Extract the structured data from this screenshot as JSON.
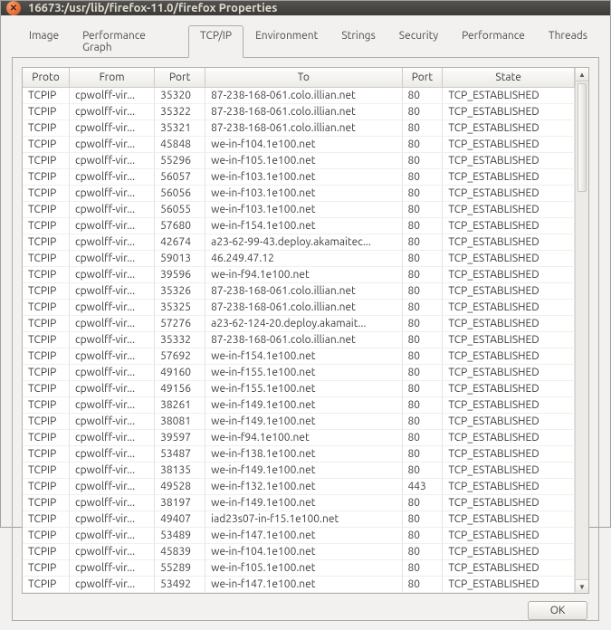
{
  "window": {
    "title": "16673:/usr/lib/firefox-11.0/firefox  Properties"
  },
  "tabs": [
    {
      "label": "Image"
    },
    {
      "label": "Performance Graph"
    },
    {
      "label": "TCP/IP",
      "active": true
    },
    {
      "label": "Environment"
    },
    {
      "label": "Strings"
    },
    {
      "label": "Security"
    },
    {
      "label": "Performance"
    },
    {
      "label": "Threads"
    }
  ],
  "table": {
    "columns": [
      "Proto",
      "From",
      "Port",
      "To",
      "Port",
      "State"
    ],
    "rows": [
      {
        "proto": "TCPIP",
        "from": "cpwolff-vir...",
        "port1": "35320",
        "to": "87-238-168-061.colo.illian.net",
        "port2": "80",
        "state": "TCP_ESTABLISHED"
      },
      {
        "proto": "TCPIP",
        "from": "cpwolff-vir...",
        "port1": "35322",
        "to": "87-238-168-061.colo.illian.net",
        "port2": "80",
        "state": "TCP_ESTABLISHED"
      },
      {
        "proto": "TCPIP",
        "from": "cpwolff-vir...",
        "port1": "35321",
        "to": "87-238-168-061.colo.illian.net",
        "port2": "80",
        "state": "TCP_ESTABLISHED"
      },
      {
        "proto": "TCPIP",
        "from": "cpwolff-vir...",
        "port1": "45848",
        "to": "we-in-f104.1e100.net",
        "port2": "80",
        "state": "TCP_ESTABLISHED"
      },
      {
        "proto": "TCPIP",
        "from": "cpwolff-vir...",
        "port1": "55296",
        "to": "we-in-f105.1e100.net",
        "port2": "80",
        "state": "TCP_ESTABLISHED"
      },
      {
        "proto": "TCPIP",
        "from": "cpwolff-vir...",
        "port1": "56057",
        "to": "we-in-f103.1e100.net",
        "port2": "80",
        "state": "TCP_ESTABLISHED"
      },
      {
        "proto": "TCPIP",
        "from": "cpwolff-vir...",
        "port1": "56056",
        "to": "we-in-f103.1e100.net",
        "port2": "80",
        "state": "TCP_ESTABLISHED"
      },
      {
        "proto": "TCPIP",
        "from": "cpwolff-vir...",
        "port1": "56055",
        "to": "we-in-f103.1e100.net",
        "port2": "80",
        "state": "TCP_ESTABLISHED"
      },
      {
        "proto": "TCPIP",
        "from": "cpwolff-vir...",
        "port1": "57680",
        "to": "we-in-f154.1e100.net",
        "port2": "80",
        "state": "TCP_ESTABLISHED"
      },
      {
        "proto": "TCPIP",
        "from": "cpwolff-vir...",
        "port1": "42674",
        "to": "a23-62-99-43.deploy.akamaitec...",
        "port2": "80",
        "state": "TCP_ESTABLISHED"
      },
      {
        "proto": "TCPIP",
        "from": "cpwolff-vir...",
        "port1": "59013",
        "to": "46.249.47.12",
        "port2": "80",
        "state": "TCP_ESTABLISHED"
      },
      {
        "proto": "TCPIP",
        "from": "cpwolff-vir...",
        "port1": "39596",
        "to": "we-in-f94.1e100.net",
        "port2": "80",
        "state": "TCP_ESTABLISHED"
      },
      {
        "proto": "TCPIP",
        "from": "cpwolff-vir...",
        "port1": "35326",
        "to": "87-238-168-061.colo.illian.net",
        "port2": "80",
        "state": "TCP_ESTABLISHED"
      },
      {
        "proto": "TCPIP",
        "from": "cpwolff-vir...",
        "port1": "35325",
        "to": "87-238-168-061.colo.illian.net",
        "port2": "80",
        "state": "TCP_ESTABLISHED"
      },
      {
        "proto": "TCPIP",
        "from": "cpwolff-vir...",
        "port1": "57276",
        "to": "a23-62-124-20.deploy.akamait...",
        "port2": "80",
        "state": "TCP_ESTABLISHED"
      },
      {
        "proto": "TCPIP",
        "from": "cpwolff-vir...",
        "port1": "35332",
        "to": "87-238-168-061.colo.illian.net",
        "port2": "80",
        "state": "TCP_ESTABLISHED"
      },
      {
        "proto": "TCPIP",
        "from": "cpwolff-vir...",
        "port1": "57692",
        "to": "we-in-f154.1e100.net",
        "port2": "80",
        "state": "TCP_ESTABLISHED"
      },
      {
        "proto": "TCPIP",
        "from": "cpwolff-vir...",
        "port1": "49160",
        "to": "we-in-f155.1e100.net",
        "port2": "80",
        "state": "TCP_ESTABLISHED"
      },
      {
        "proto": "TCPIP",
        "from": "cpwolff-vir...",
        "port1": "49156",
        "to": "we-in-f155.1e100.net",
        "port2": "80",
        "state": "TCP_ESTABLISHED"
      },
      {
        "proto": "TCPIP",
        "from": "cpwolff-vir...",
        "port1": "38261",
        "to": "we-in-f149.1e100.net",
        "port2": "80",
        "state": "TCP_ESTABLISHED"
      },
      {
        "proto": "TCPIP",
        "from": "cpwolff-vir...",
        "port1": "38081",
        "to": "we-in-f149.1e100.net",
        "port2": "80",
        "state": "TCP_ESTABLISHED"
      },
      {
        "proto": "TCPIP",
        "from": "cpwolff-vir...",
        "port1": "39597",
        "to": "we-in-f94.1e100.net",
        "port2": "80",
        "state": "TCP_ESTABLISHED"
      },
      {
        "proto": "TCPIP",
        "from": "cpwolff-vir...",
        "port1": "53487",
        "to": "we-in-f138.1e100.net",
        "port2": "80",
        "state": "TCP_ESTABLISHED"
      },
      {
        "proto": "TCPIP",
        "from": "cpwolff-vir...",
        "port1": "38135",
        "to": "we-in-f149.1e100.net",
        "port2": "80",
        "state": "TCP_ESTABLISHED"
      },
      {
        "proto": "TCPIP",
        "from": "cpwolff-vir...",
        "port1": "49528",
        "to": "we-in-f132.1e100.net",
        "port2": "443",
        "state": "TCP_ESTABLISHED"
      },
      {
        "proto": "TCPIP",
        "from": "cpwolff-vir...",
        "port1": "38197",
        "to": "we-in-f149.1e100.net",
        "port2": "80",
        "state": "TCP_ESTABLISHED"
      },
      {
        "proto": "TCPIP",
        "from": "cpwolff-vir...",
        "port1": "49407",
        "to": "iad23s07-in-f15.1e100.net",
        "port2": "80",
        "state": "TCP_ESTABLISHED"
      },
      {
        "proto": "TCPIP",
        "from": "cpwolff-vir...",
        "port1": "53489",
        "to": "we-in-f147.1e100.net",
        "port2": "80",
        "state": "TCP_ESTABLISHED"
      },
      {
        "proto": "TCPIP",
        "from": "cpwolff-vir...",
        "port1": "45839",
        "to": "we-in-f104.1e100.net",
        "port2": "80",
        "state": "TCP_ESTABLISHED"
      },
      {
        "proto": "TCPIP",
        "from": "cpwolff-vir...",
        "port1": "55289",
        "to": "we-in-f105.1e100.net",
        "port2": "80",
        "state": "TCP_ESTABLISHED"
      },
      {
        "proto": "TCPIP",
        "from": "cpwolff-vir...",
        "port1": "53492",
        "to": "we-in-f147.1e100.net",
        "port2": "80",
        "state": "TCP_ESTABLISHED"
      }
    ]
  },
  "buttons": {
    "ok": "OK"
  }
}
